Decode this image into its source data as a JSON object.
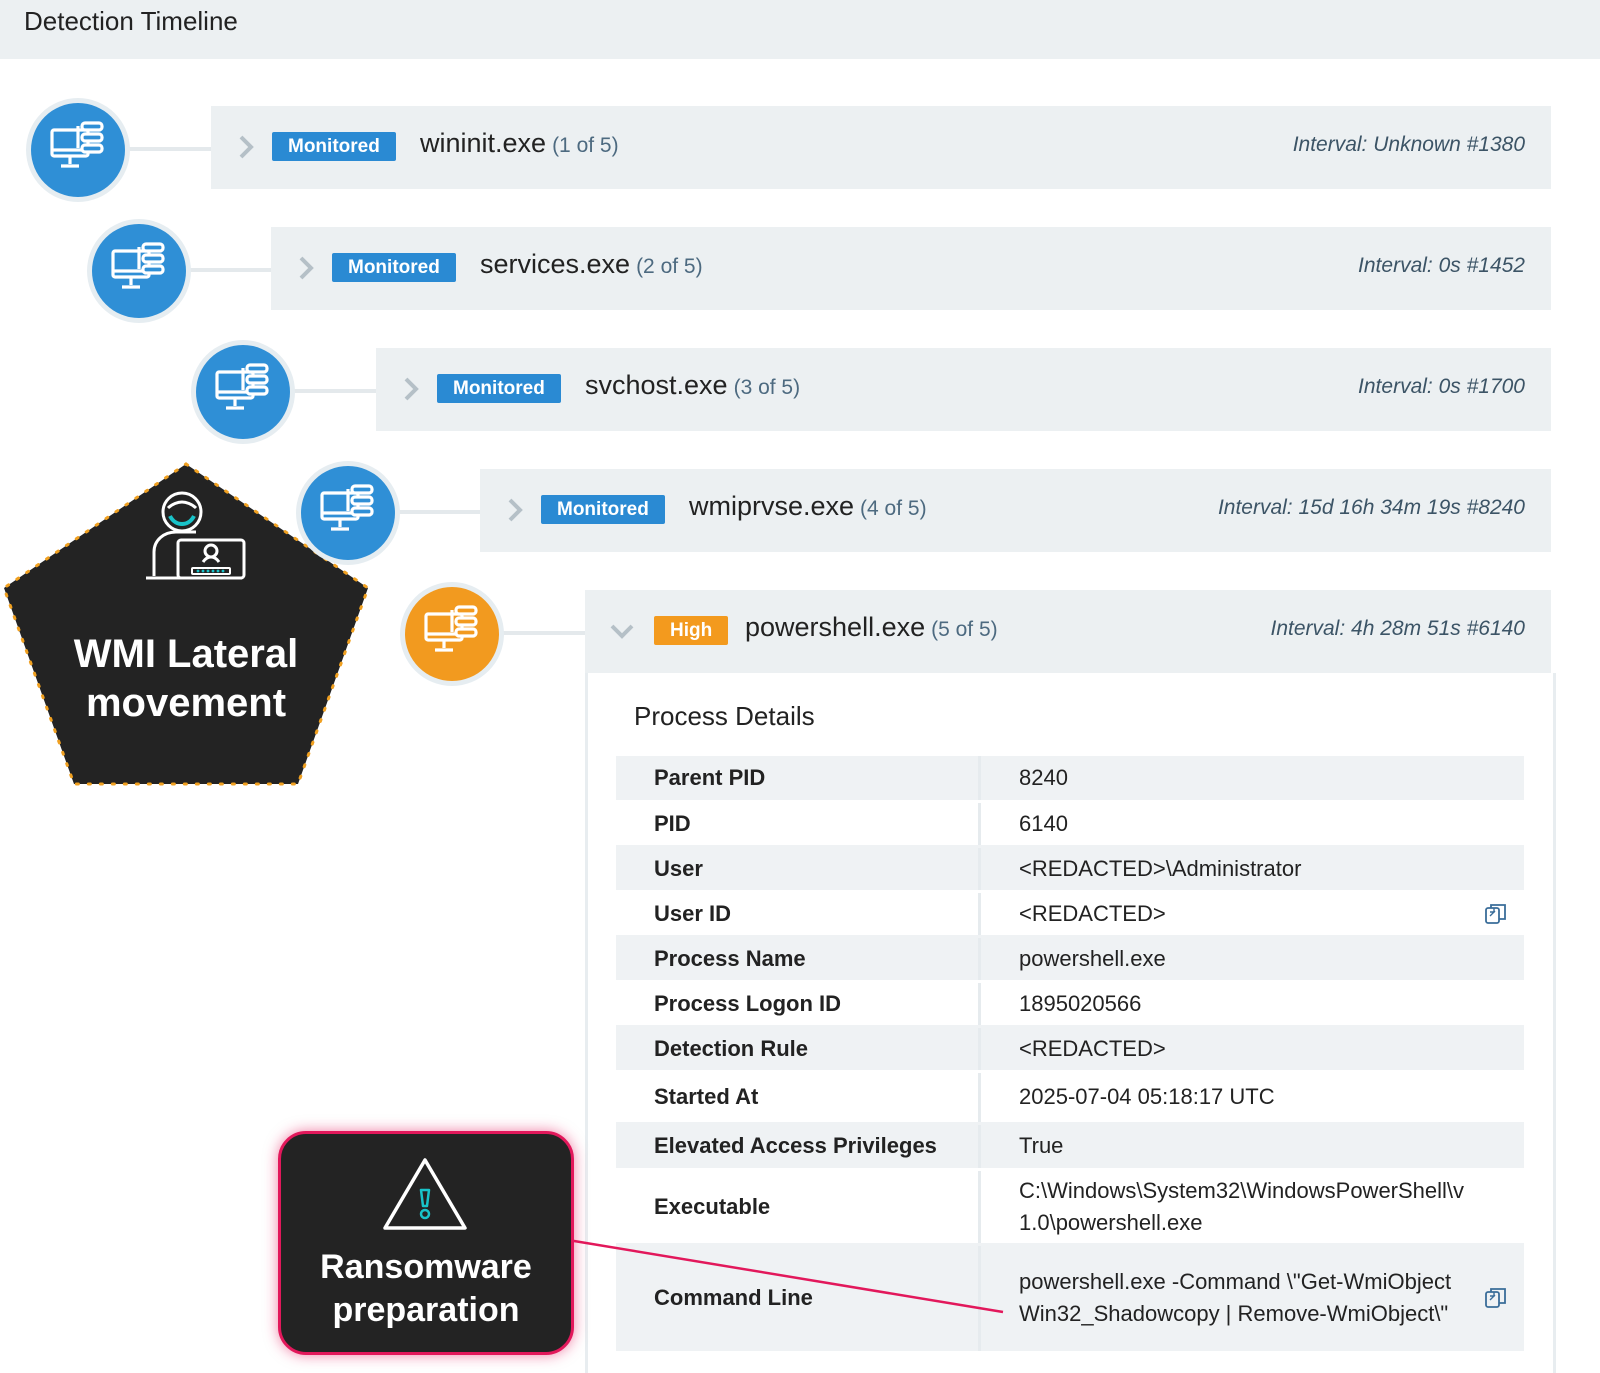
{
  "header": {
    "title": "Detection Timeline"
  },
  "timeline": [
    {
      "badge": "Monitored",
      "name": "wininit.exe",
      "count": "(1 of 5)",
      "interval": "Interval: Unknown #1380",
      "severity_color": "#2a8ad3"
    },
    {
      "badge": "Monitored",
      "name": "services.exe",
      "count": "(2 of 5)",
      "interval": "Interval: 0s #1452",
      "severity_color": "#2a8ad3"
    },
    {
      "badge": "Monitored",
      "name": "svchost.exe",
      "count": "(3 of 5)",
      "interval": "Interval: 0s #1700",
      "severity_color": "#2a8ad3"
    },
    {
      "badge": "Monitored",
      "name": "wmiprvse.exe",
      "count": "(4 of 5)",
      "interval": "Interval: 15d 16h 34m 19s #8240",
      "severity_color": "#2a8ad3"
    },
    {
      "badge": "High",
      "name": "powershell.exe",
      "count": "(5 of 5)",
      "interval": "Interval: 4h 28m 51s #6140",
      "severity_color": "#f39a1e"
    }
  ],
  "process_details": {
    "title": "Process Details",
    "rows": [
      {
        "key": "Parent PID",
        "value": "8240"
      },
      {
        "key": "PID",
        "value": "6140"
      },
      {
        "key": "User",
        "value": "<REDACTED>\\Administrator"
      },
      {
        "key": "User ID",
        "value": "<REDACTED>",
        "copy_icon": true
      },
      {
        "key": "Process Name",
        "value": "powershell.exe"
      },
      {
        "key": "Process Logon ID",
        "value": "1895020566"
      },
      {
        "key": "Detection Rule",
        "value": "<REDACTED>"
      },
      {
        "key": "Started At",
        "value": "2025-07-04 05:18:17 UTC"
      },
      {
        "key": "Elevated Access Privileges",
        "value": "True"
      },
      {
        "key": "Executable",
        "value": "C:\\Windows\\System32\\WindowsPowerShell\\v1.0\\powershell.exe"
      },
      {
        "key": "Command Line",
        "value": "powershell.exe -Command \\\"Get-WmiObject Win32_Shadowcopy | Remove-WmiObject\\\"",
        "copy_icon": true
      }
    ]
  },
  "annotations": {
    "wmi": "WMI Lateral movement",
    "ransomware": "Ransomware preparation"
  },
  "icons": {
    "node": "process-tree-computer-icon",
    "chevron": "chevron-right-icon",
    "chevron_open": "chevron-down-icon",
    "copy": "copy-icon",
    "attacker": "hacker-icon",
    "warning": "warning-triangle-icon"
  }
}
